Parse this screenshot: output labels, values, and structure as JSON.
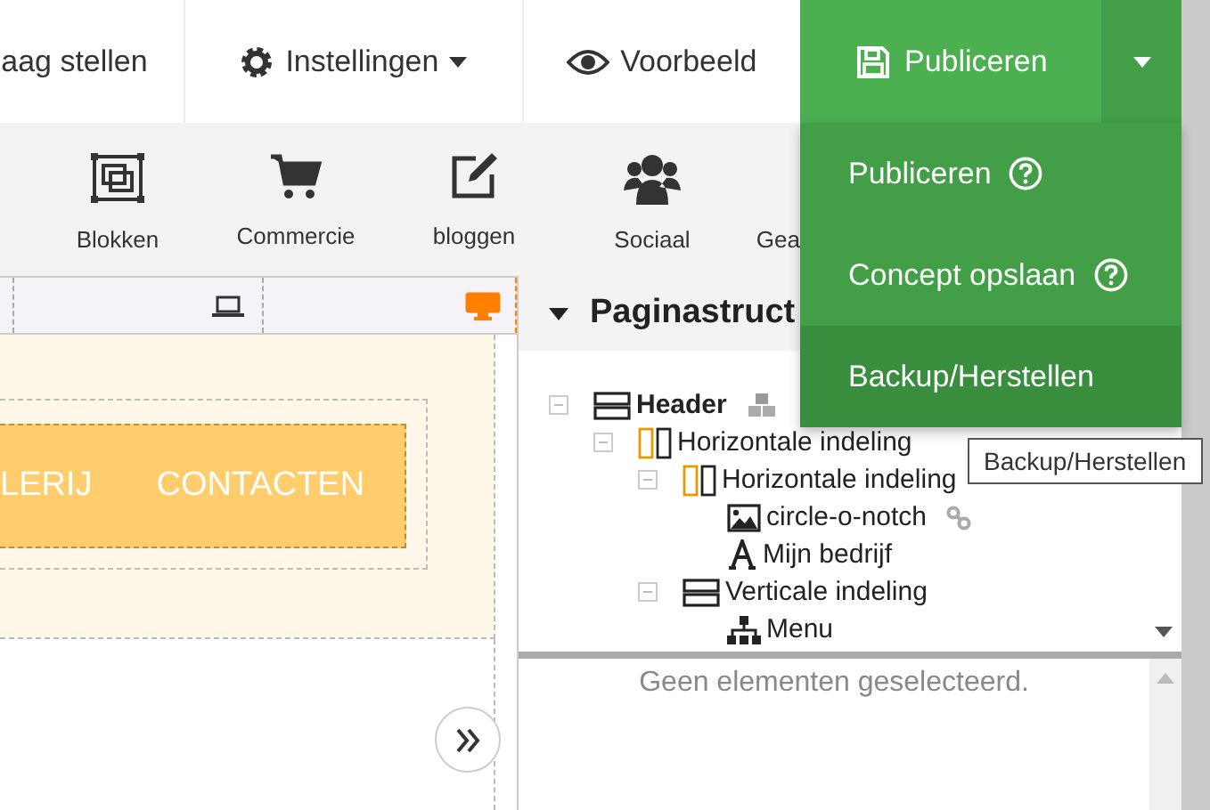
{
  "top_bar": {
    "items": [
      {
        "label": "aag stellen",
        "kind": "text"
      },
      {
        "label": "Instellingen",
        "kind": "settings"
      },
      {
        "label": "Voorbeeld",
        "kind": "preview"
      }
    ],
    "publish": {
      "label": "Publiceren"
    }
  },
  "toolbar": {
    "items": [
      {
        "label": "Blokken",
        "kind": "blocks"
      },
      {
        "label": "Commercie",
        "kind": "cart"
      },
      {
        "label": "bloggen",
        "kind": "edit"
      },
      {
        "label": "Sociaal",
        "kind": "users"
      },
      {
        "label": "Gea",
        "kind": "none"
      }
    ]
  },
  "canvas": {
    "devices": [
      {
        "kind": "laptop",
        "selected": false
      },
      {
        "kind": "desktop",
        "selected": true
      }
    ],
    "menu_items": [
      "LERIJ",
      "CONTACTEN"
    ]
  },
  "structure": {
    "title": "Paginastruct",
    "tree": [
      {
        "label": "Header",
        "kind": "rows",
        "expanded": true,
        "shared": true,
        "linked": false,
        "children": [
          {
            "label": "Horizontale indeling",
            "kind": "columns",
            "expanded": true,
            "shared": false,
            "linked": false,
            "children": [
              {
                "label": "Horizontale indeling",
                "kind": "columns",
                "expanded": true,
                "shared": false,
                "linked": false,
                "children": [
                  {
                    "label": "circle-o-notch",
                    "kind": "image",
                    "shared": false,
                    "linked": true
                  },
                  {
                    "label": "Mijn bedrijf",
                    "kind": "text",
                    "shared": false,
                    "linked": false
                  }
                ]
              },
              {
                "label": "Verticale indeling",
                "kind": "rows",
                "expanded": true,
                "shared": false,
                "linked": false,
                "children": [
                  {
                    "label": "Menu",
                    "kind": "sitemap",
                    "shared": false,
                    "linked": false
                  }
                ]
              }
            ]
          }
        ]
      }
    ],
    "empty_text": "Geen elementen geselecteerd."
  },
  "publish_menu": {
    "items": [
      {
        "label": "Publiceren",
        "help": true,
        "hovered": false
      },
      {
        "label": "Concept opslaan",
        "help": true,
        "hovered": false
      },
      {
        "label": "Backup/Herstellen",
        "help": false,
        "hovered": true
      }
    ]
  },
  "tooltip": "Backup/Herstellen"
}
